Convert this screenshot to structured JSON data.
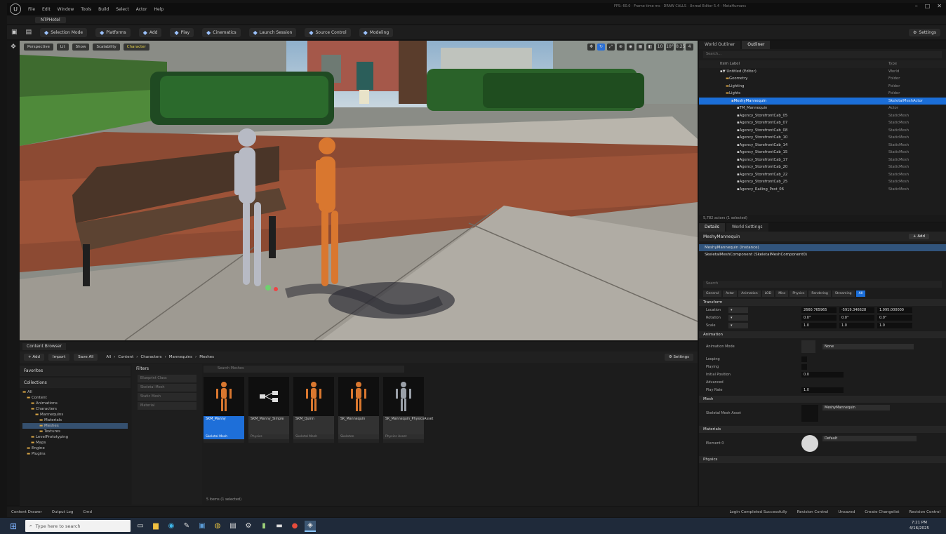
{
  "titlebar": {
    "logo": "U",
    "menu": [
      "File",
      "Edit",
      "Window",
      "Tools",
      "Build",
      "Select",
      "Actor",
      "Help"
    ],
    "stats": "FPS: 60.0   ·   Frame time ms   ·   DRAW CALLS   ·   Unreal Editor 5.4 - MetaHumans",
    "level_tab": "NTPHotel"
  },
  "toolbar": {
    "buttons": [
      "Selection Mode",
      "Platforms",
      "Add",
      "Play",
      "Cinematics",
      "Launch Session",
      "Source Control",
      "Modeling"
    ],
    "settings": "Settings"
  },
  "viewport": {
    "chips": [
      "Perspective",
      "Lit",
      "Show",
      "Scalability",
      "Character"
    ],
    "tool_icons": [
      "✥",
      "↻",
      "⤢",
      "⊕",
      "◉",
      "▦",
      "◧",
      "10",
      "10°",
      "0.25",
      "4"
    ]
  },
  "content_browser": {
    "tab": "Content Browser",
    "buttons": [
      "+ Add",
      "Import",
      "Save All"
    ],
    "breadcrumb": [
      "All",
      "Content",
      "Characters",
      "Mannequins",
      "Meshes"
    ],
    "settings": "Settings",
    "favorites": "Favorites",
    "collections": "Collections",
    "tree": [
      {
        "label": "All",
        "sel": false,
        "depth": 0
      },
      {
        "label": "Content",
        "sel": false,
        "depth": 1
      },
      {
        "label": "Animations",
        "sel": false,
        "depth": 2
      },
      {
        "label": "Characters",
        "sel": false,
        "depth": 2
      },
      {
        "label": "Mannequins",
        "sel": false,
        "depth": 3
      },
      {
        "label": "Materials",
        "sel": false,
        "depth": 4
      },
      {
        "label": "Meshes",
        "sel": true,
        "depth": 4
      },
      {
        "label": "Textures",
        "sel": false,
        "depth": 4
      },
      {
        "label": "LevelPrototyping",
        "sel": false,
        "depth": 2
      },
      {
        "label": "Maps",
        "sel": false,
        "depth": 2
      },
      {
        "label": "Engine",
        "sel": false,
        "depth": 1
      },
      {
        "label": "Plugins",
        "sel": false,
        "depth": 1
      }
    ],
    "filters_title": "Filters",
    "filter_items": [
      "Blueprint Class",
      "Skeletal Mesh",
      "Static Mesh",
      "Material"
    ],
    "search_placeholder": "Search Meshes",
    "assets": [
      {
        "name": "SKM_Manny",
        "type": "Skeletal Mesh",
        "selected": true,
        "thumb": "orange"
      },
      {
        "name": "SKM_Manny_Simple",
        "type": "Physics",
        "selected": false,
        "thumb": "node"
      },
      {
        "name": "SKM_Quinn",
        "type": "Skeletal Mesh",
        "selected": false,
        "thumb": "orange"
      },
      {
        "name": "SK_Mannequin",
        "type": "Skeleton",
        "selected": false,
        "thumb": "orange"
      },
      {
        "name": "SK_Mannequin_PhysicsAsset",
        "type": "Physics Asset",
        "selected": false,
        "thumb": "grey"
      }
    ],
    "count": "5 items (1 selected)"
  },
  "outliner": {
    "tabs": [
      "World Outliner",
      "Outliner"
    ],
    "search_placeholder": "Search...",
    "col_label": "Item Label",
    "col_type": "Type",
    "rows": [
      {
        "label": "▼ Untitled (Editor)",
        "type": "World",
        "depth": 0,
        "sel": false
      },
      {
        "label": "Geometry",
        "type": "Folder",
        "depth": 1,
        "sel": false
      },
      {
        "label": "Lighting",
        "type": "Folder",
        "depth": 1,
        "sel": false
      },
      {
        "label": "Lights",
        "type": "Folder",
        "depth": 1,
        "sel": false
      },
      {
        "label": "MeshyMannequin",
        "type": "SkeletalMeshActor",
        "depth": 2,
        "sel": true
      },
      {
        "label": "TM_Mannequin",
        "type": "Actor",
        "depth": 3,
        "sel": false
      },
      {
        "label": "Agency_StorefrontCab_05",
        "type": "StaticMesh",
        "depth": 3,
        "sel": false
      },
      {
        "label": "Agency_StorefrontCab_07",
        "type": "StaticMesh",
        "depth": 3,
        "sel": false
      },
      {
        "label": "Agency_StorefrontCab_08",
        "type": "StaticMesh",
        "depth": 3,
        "sel": false
      },
      {
        "label": "Agency_StorefrontCab_10",
        "type": "StaticMesh",
        "depth": 3,
        "sel": false
      },
      {
        "label": "Agency_StorefrontCab_14",
        "type": "StaticMesh",
        "depth": 3,
        "sel": false
      },
      {
        "label": "Agency_StorefrontCab_15",
        "type": "StaticMesh",
        "depth": 3,
        "sel": false
      },
      {
        "label": "Agency_StorefrontCab_17",
        "type": "StaticMesh",
        "depth": 3,
        "sel": false
      },
      {
        "label": "Agency_StorefrontCab_20",
        "type": "StaticMesh",
        "depth": 3,
        "sel": false
      },
      {
        "label": "Agency_StorefrontCab_22",
        "type": "StaticMesh",
        "depth": 3,
        "sel": false
      },
      {
        "label": "Agency_StorefrontCab_25",
        "type": "StaticMesh",
        "depth": 3,
        "sel": false
      },
      {
        "label": "Agency_Railing_Post_06",
        "type": "StaticMesh",
        "depth": 3,
        "sel": false
      }
    ],
    "footer": "5,782 actors (1 selected)"
  },
  "details": {
    "tabs": [
      "Details",
      "World Settings"
    ],
    "actor": "MeshyMannequin",
    "add": "+ Add",
    "components": [
      "MeshyMannequin (Instance)",
      "SkeletalMeshComponent (SkeletalMeshComponent0)"
    ],
    "search_placeholder": "Search",
    "cat_tabs": [
      "General",
      "Actor",
      "Animation",
      "LOD",
      "Misc",
      "Physics",
      "Rendering",
      "Streaming",
      "All"
    ],
    "transform": "Transform",
    "location": "Location",
    "rotation": "Rotation",
    "scale": "Scale",
    "loc_vals": [
      "2660.765965",
      "-5919.346628",
      "1.995.000000"
    ],
    "rot_vals": [
      "0.0°",
      "0.0°",
      "0.0°"
    ],
    "scale_vals": [
      "1.0",
      "1.0",
      "1.0"
    ],
    "animation": "Animation",
    "anim_mode": "Animation Mode",
    "anim_mode_val": "None",
    "anim_props": [
      [
        "Looping",
        ""
      ],
      [
        "Playing",
        ""
      ],
      [
        "Initial Position",
        "0.0"
      ]
    ],
    "advanced": "Advanced",
    "play_rate": "Play Rate",
    "play_rate_val": "1.0",
    "mesh": "Mesh",
    "skeletal_asset": "Skeletal Mesh Asset",
    "skeletal_asset_val": "MeshyMannequin",
    "materials": "Materials",
    "element0": "Element 0",
    "element0_val": "Default",
    "physics": "Physics"
  },
  "statusbar": {
    "items": [
      "Content Drawer",
      "Output Log",
      "Cmd"
    ],
    "right": [
      "Login Completed Successfully",
      "Revision Control",
      "Unsaved",
      "Create Changelist",
      "Revision Control"
    ]
  },
  "taskbar": {
    "search_placeholder": "Type here to search",
    "time": "7:21 PM",
    "date": "4/16/2025"
  }
}
